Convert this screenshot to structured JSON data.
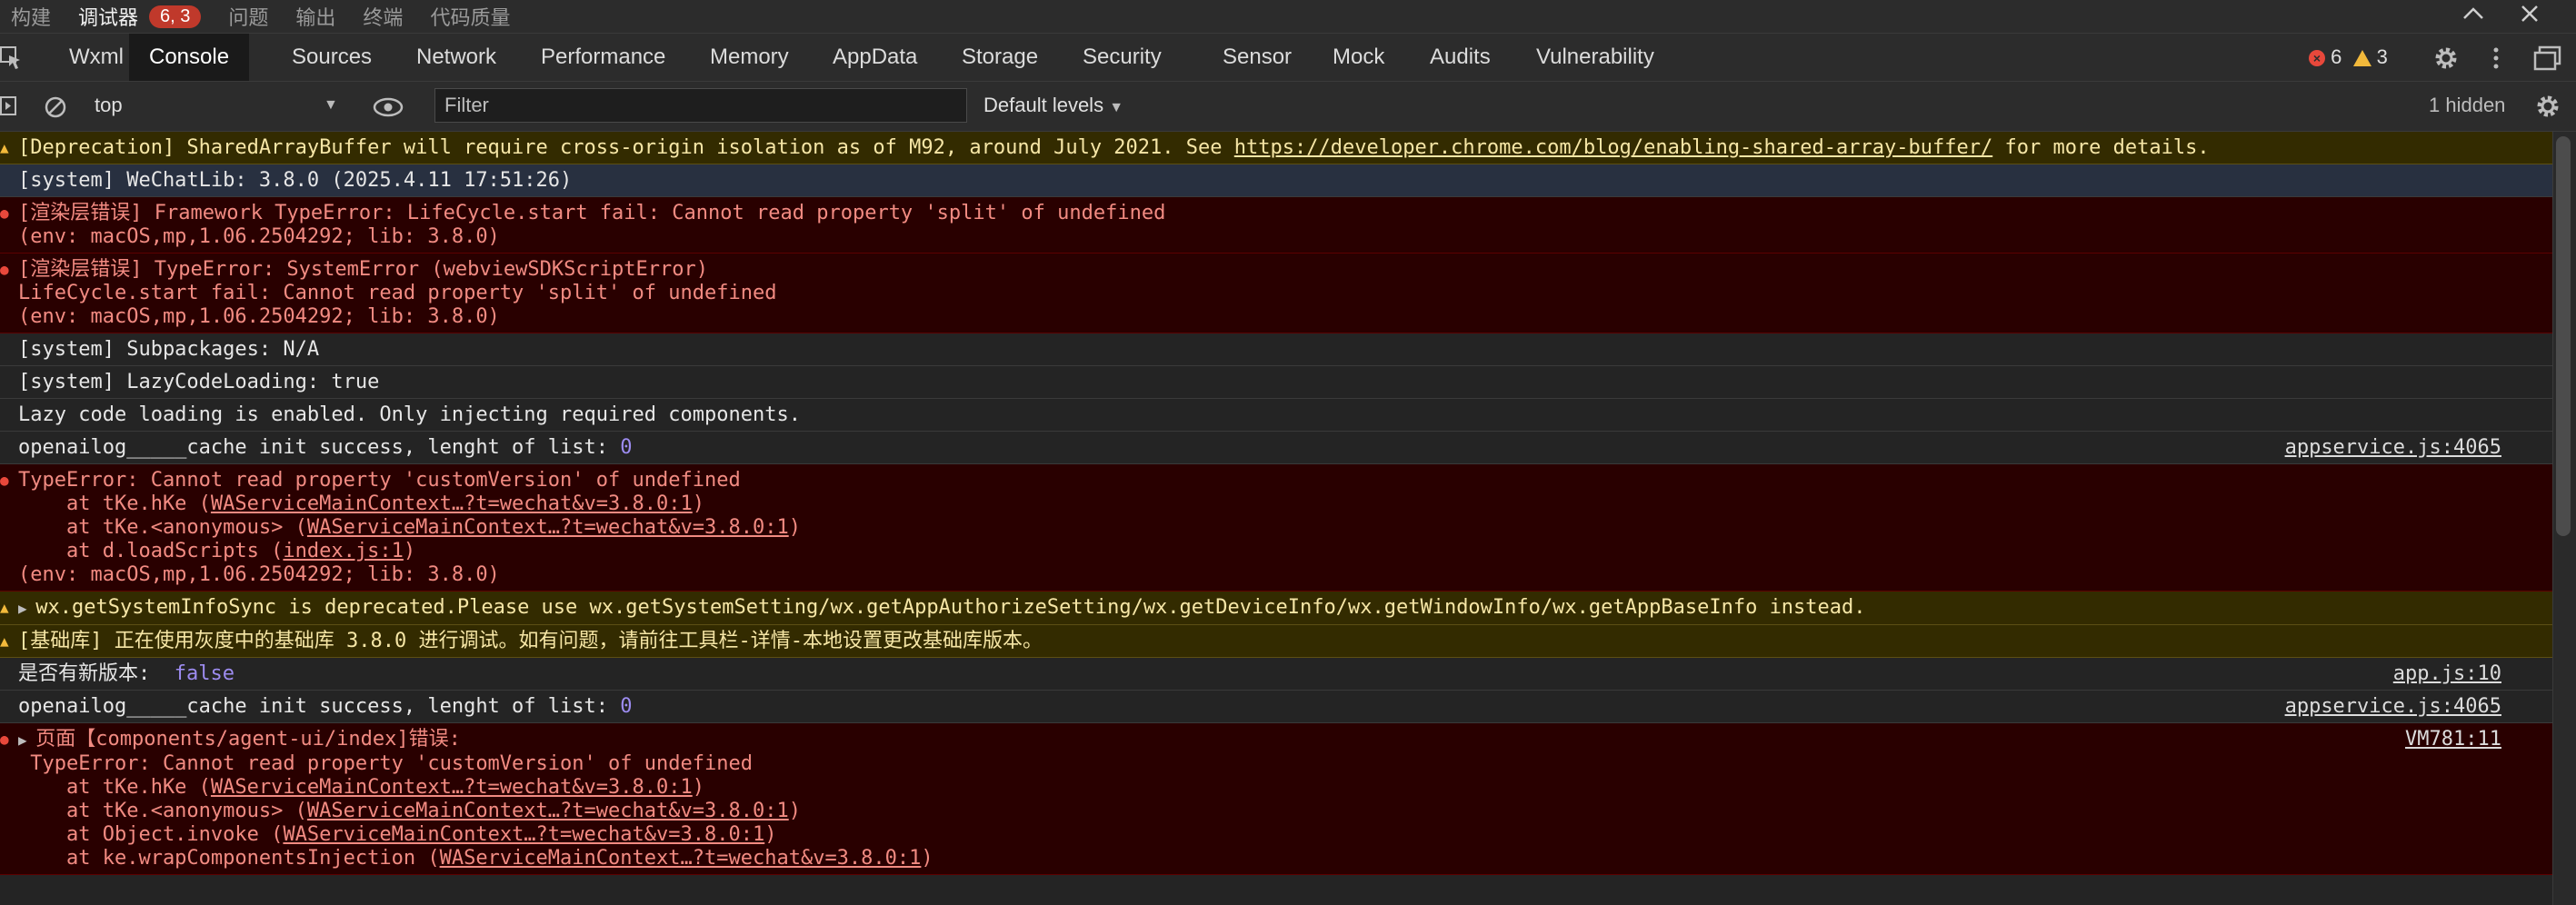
{
  "top_tabs": [
    {
      "label": "构建"
    },
    {
      "label": "调试器",
      "badge": "6, 3"
    },
    {
      "label": "问题"
    },
    {
      "label": "输出"
    },
    {
      "label": "终端"
    },
    {
      "label": "代码质量"
    }
  ],
  "panel_tabs": [
    "Wxml",
    "Console",
    "Sources",
    "Network",
    "Performance",
    "Memory",
    "AppData",
    "Storage",
    "Security",
    "Sensor",
    "Mock",
    "Audits",
    "Vulnerability"
  ],
  "active_panel": "Console",
  "counts": {
    "errors": "6",
    "warnings": "3"
  },
  "filterbar": {
    "context": "top",
    "filter_placeholder": "Filter",
    "levels": "Default levels",
    "hidden": "1 hidden"
  },
  "messages": [
    {
      "level": "warning",
      "segments": [
        {
          "text": "[Deprecation] SharedArrayBuffer will require cross-origin isolation as of M92, around July 2021. See "
        },
        {
          "text": "https://developer.chrome.com/blog/enabling-shared-array-buffer/",
          "link": true
        },
        {
          "text": " for more details."
        }
      ]
    },
    {
      "level": "system",
      "text": "[system] WeChatLib: 3.8.0 (2025.4.11 17:51:26)"
    },
    {
      "level": "error",
      "text": "[渲染层错误] Framework TypeError: LifeCycle.start fail: Cannot read property 'split' of undefined\n(env: macOS,mp,1.06.2504292; lib: 3.8.0)"
    },
    {
      "level": "error",
      "text": "[渲染层错误] TypeError: SystemError (webviewSDKScriptError)\nLifeCycle.start fail: Cannot read property 'split' of undefined\n(env: macOS,mp,1.06.2504292; lib: 3.8.0)"
    },
    {
      "level": "info",
      "text": "[system] Subpackages: N/A"
    },
    {
      "level": "info",
      "text": "[system] LazyCodeLoading: true"
    },
    {
      "level": "info",
      "text": "Lazy code loading is enabled. Only injecting required components."
    },
    {
      "level": "info",
      "segments": [
        {
          "text": "openailog_____cache init success, lenght of list: "
        },
        {
          "text": "0",
          "num": true
        }
      ],
      "source": "appservice.js:4065"
    },
    {
      "level": "error",
      "segments": [
        {
          "text": "TypeError: Cannot read property 'customVersion' of undefined\n    at tKe.hKe ("
        },
        {
          "text": "WAServiceMainContext…?t=wechat&v=3.8.0:1",
          "link": true
        },
        {
          "text": ")\n    at tKe.<anonymous> ("
        },
        {
          "text": "WAServiceMainContext…?t=wechat&v=3.8.0:1",
          "link": true
        },
        {
          "text": ")\n    at d.loadScripts ("
        },
        {
          "text": "index.js:1",
          "link": true
        },
        {
          "text": ")\n(env: macOS,mp,1.06.2504292; lib: 3.8.0)"
        }
      ]
    },
    {
      "level": "warning",
      "expandable": true,
      "text": "wx.getSystemInfoSync is deprecated.Please use wx.getSystemSetting/wx.getAppAuthorizeSetting/wx.getDeviceInfo/wx.getWindowInfo/wx.getAppBaseInfo instead."
    },
    {
      "level": "warning",
      "text": "[基础库] 正在使用灰度中的基础库 3.8.0 进行调试。如有问题，请前往工具栏-详情-本地设置更改基础库版本。"
    },
    {
      "level": "info",
      "segments": [
        {
          "text": "是否有新版本:  "
        },
        {
          "text": "false",
          "num": true
        }
      ],
      "source": "app.js:10"
    },
    {
      "level": "info",
      "segments": [
        {
          "text": "openailog_____cache init success, lenght of list: "
        },
        {
          "text": "0",
          "num": true
        }
      ],
      "source": "appservice.js:4065"
    },
    {
      "level": "error",
      "expandable": true,
      "source": "VM781:11",
      "segments": [
        {
          "text": "页面【components/agent-ui/index]错误:\n TypeError: Cannot read property 'customVersion' of undefined\n    at tKe.hKe ("
        },
        {
          "text": "WAServiceMainContext…?t=wechat&v=3.8.0:1",
          "link": true
        },
        {
          "text": ")\n    at tKe.<anonymous> ("
        },
        {
          "text": "WAServiceMainContext…?t=wechat&v=3.8.0:1",
          "link": true
        },
        {
          "text": ")\n    at Object.invoke ("
        },
        {
          "text": "WAServiceMainContext…?t=wechat&v=3.8.0:1",
          "link": true
        },
        {
          "text": ")\n    at ke.wrapComponentsInjection ("
        },
        {
          "text": "WAServiceMainContext…?t=wechat&v=3.8.0:1",
          "link": true
        },
        {
          "text": ")"
        }
      ]
    }
  ],
  "icons": {
    "inspect": "inspect-element-icon",
    "clear": "clear-console-icon",
    "eye": "live-expression-eye-icon",
    "settings": "gear-icon",
    "more": "kebab-menu-icon",
    "dock": "dock-side-icon"
  },
  "colors": {
    "error_bg": "#290000",
    "error_text": "#f28b82",
    "warning_bg": "#332b00",
    "warning_text": "#f6e6a6",
    "badge": "#c0392b",
    "number": "#9d8cf0"
  }
}
